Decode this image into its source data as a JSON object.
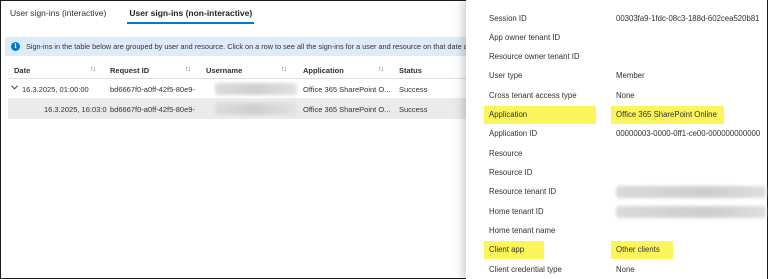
{
  "tabs": [
    {
      "label": "User sign-ins (interactive)"
    },
    {
      "label": "User sign-ins (non-interactive)"
    }
  ],
  "banner": {
    "text": "Sign-ins in the table below are grouped by user and resource. Click on a row to see all the sign-ins for a user and resource on that date a"
  },
  "table": {
    "headers": [
      "Date",
      "Request ID",
      "Username",
      "Application",
      "Status"
    ],
    "rows": [
      {
        "date": "16.3.2025, 01:00:00",
        "request_id": "bd6667f0-a0ff-42f5-80e9-",
        "application": "Office 365 SharePoint O...",
        "status": "Success"
      },
      {
        "date": "16.3.2025, 16:03:0",
        "request_id": "bd6667f0-a0ff-42f5-80e9-",
        "application": "Office 365 SharePoint O...",
        "status": "Success"
      }
    ]
  },
  "details": {
    "session_id": {
      "label": "Session ID",
      "value": "00303fa9-1fdc-08c3-188d-602cea520b81"
    },
    "app_owner_tenant_id": {
      "label": "App owner tenant ID",
      "value": ""
    },
    "resource_owner_tenant_id": {
      "label": "Resource owner tenant ID",
      "value": ""
    },
    "user_type": {
      "label": "User type",
      "value": "Member"
    },
    "cross_tenant_access_type": {
      "label": "Cross tenant access type",
      "value": "None"
    },
    "application": {
      "label": "Application",
      "value": "Office 365 SharePoint Online"
    },
    "application_id": {
      "label": "Application ID",
      "value": "00000003-0000-0ff1-ce00-000000000000"
    },
    "resource": {
      "label": "Resource",
      "value": ""
    },
    "resource_id": {
      "label": "Resource ID",
      "value": ""
    },
    "resource_tenant_id": {
      "label": "Resource tenant ID",
      "value": ""
    },
    "home_tenant_id": {
      "label": "Home tenant ID",
      "value": ""
    },
    "home_tenant_name": {
      "label": "Home tenant name",
      "value": ""
    },
    "client_app": {
      "label": "Client app",
      "value": "Other clients"
    },
    "client_credential_type": {
      "label": "Client credential type",
      "value": "None"
    }
  },
  "colors": {
    "accent": "#0078d4",
    "highlight": "#fcf65c",
    "banner_bg": "#deecf9",
    "selected_row": "#edebe9"
  },
  "icons": [
    "info-icon",
    "chevron-down-icon",
    "sort-icon"
  ]
}
